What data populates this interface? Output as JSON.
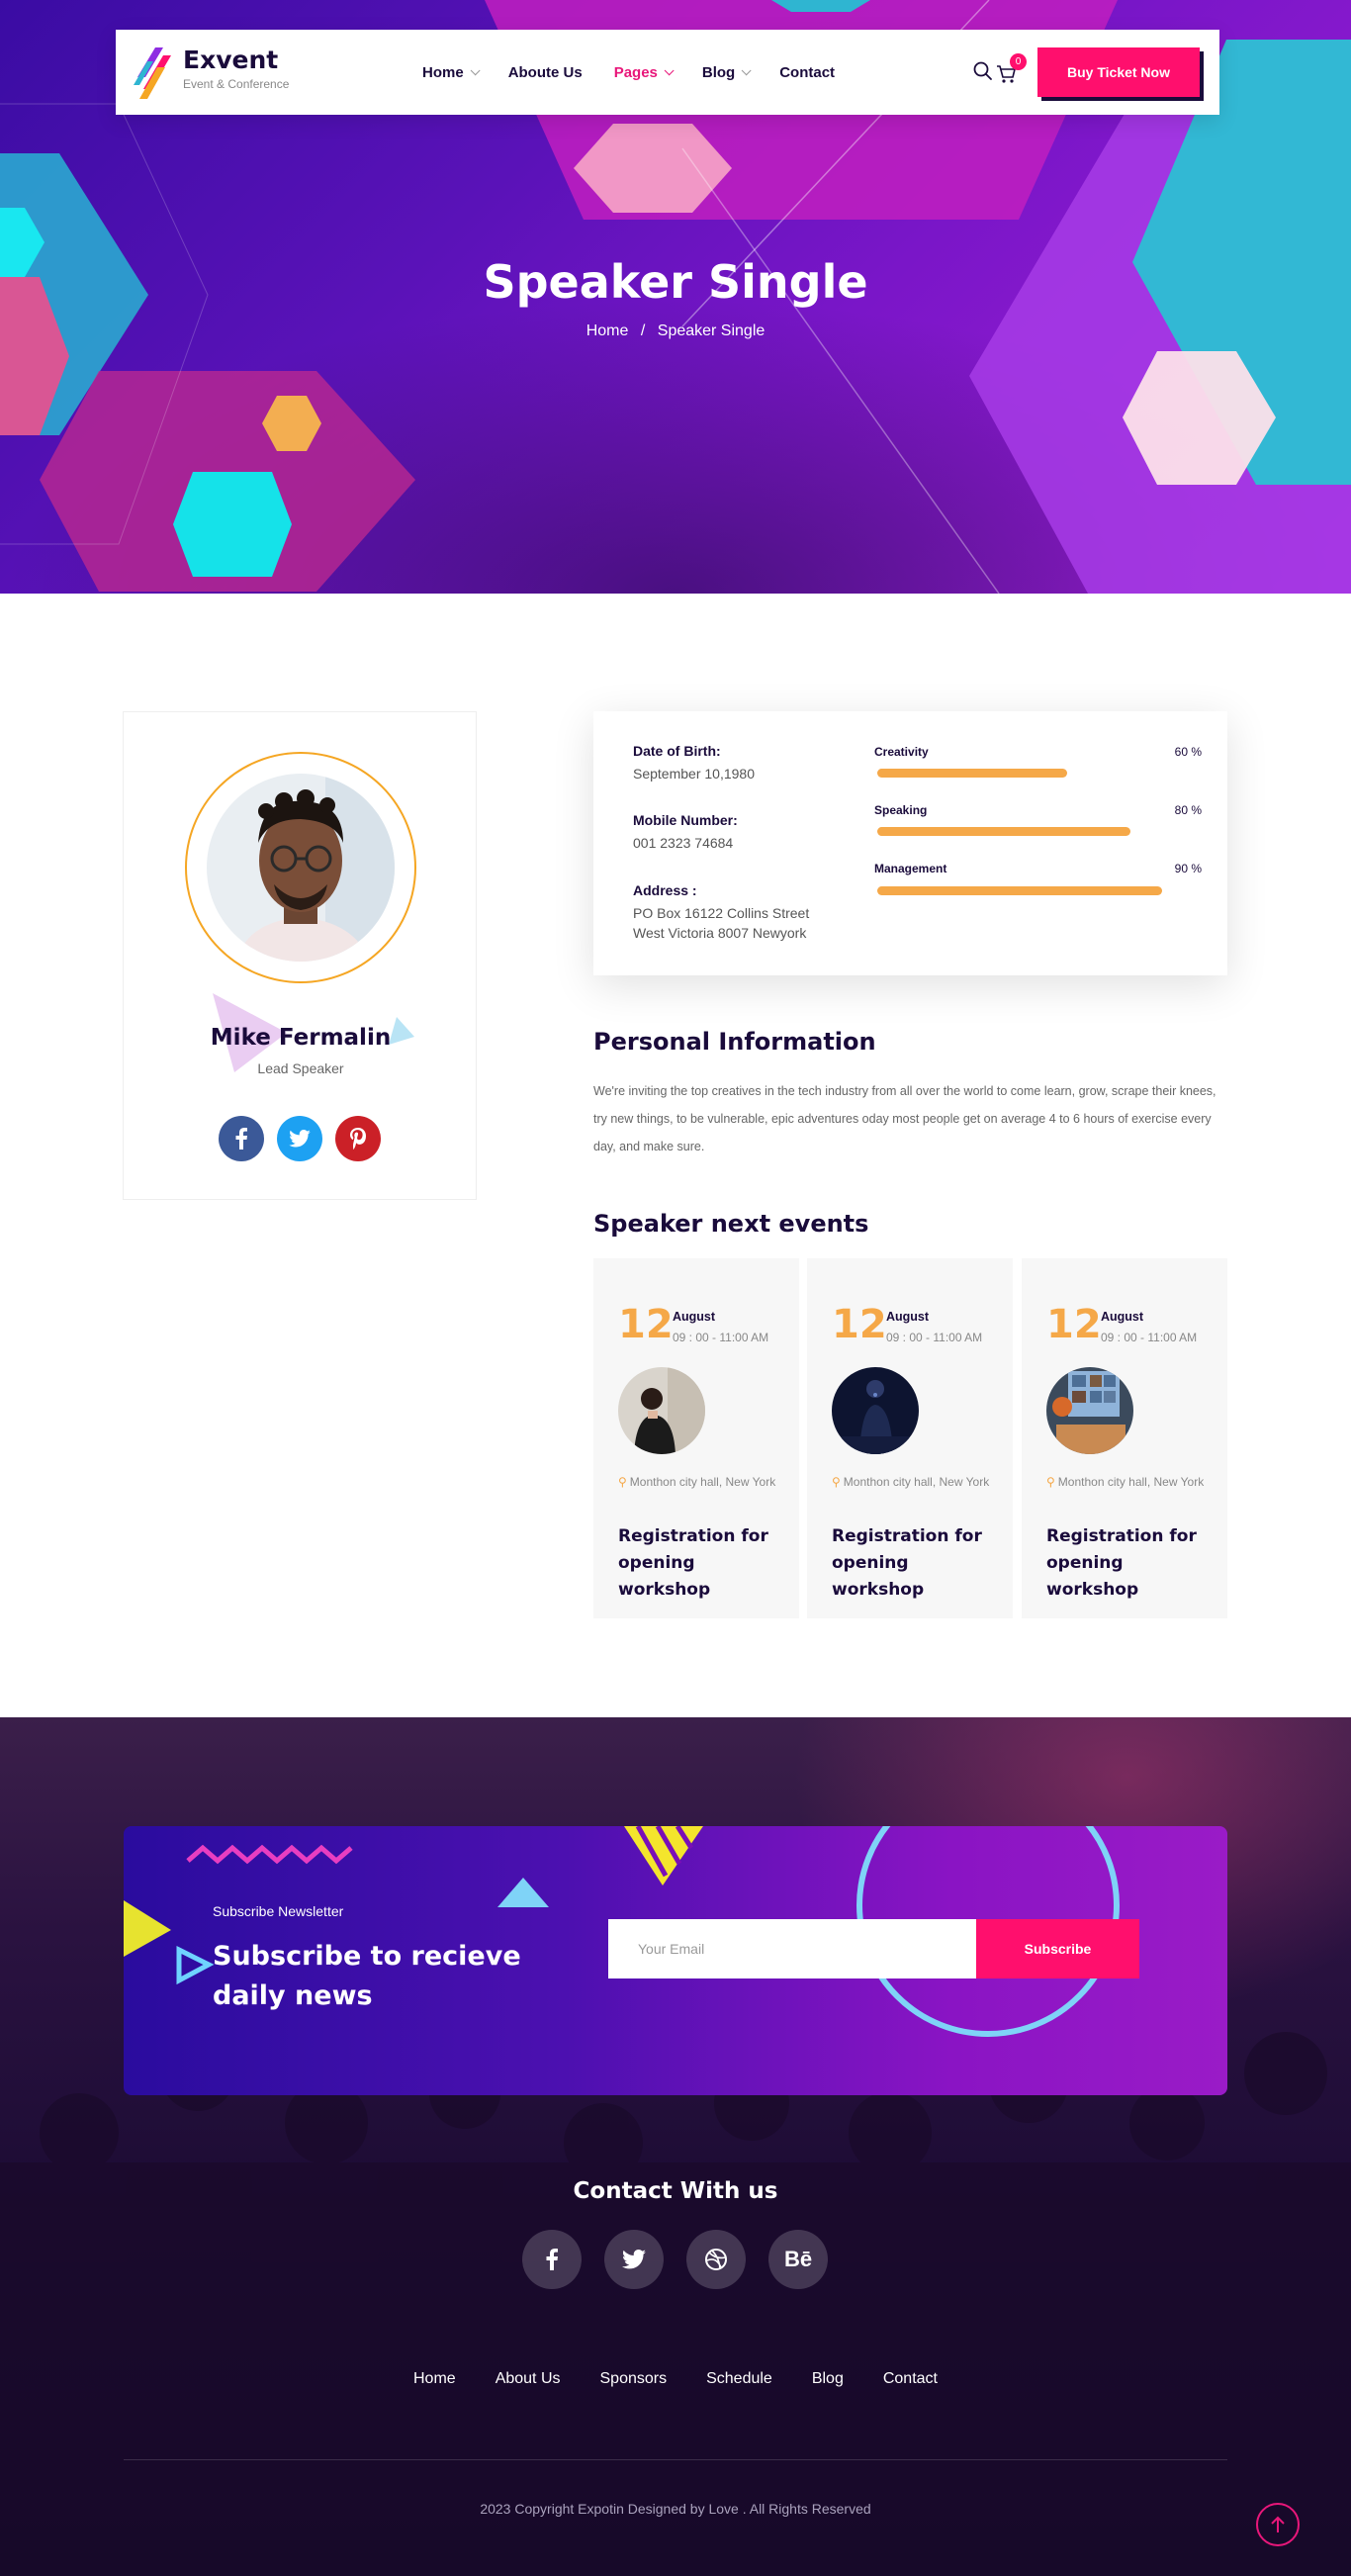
{
  "brand": {
    "name": "Exvent",
    "tagline": "Event & Conference"
  },
  "nav": {
    "items": [
      {
        "label": "Home",
        "has_dropdown": true,
        "active": false
      },
      {
        "label": "Aboute Us",
        "has_dropdown": false,
        "active": false
      },
      {
        "label": "Pages",
        "has_dropdown": true,
        "active": true
      },
      {
        "label": "Blog",
        "has_dropdown": true,
        "active": false
      },
      {
        "label": "Contact",
        "has_dropdown": false,
        "active": false
      }
    ],
    "cart_count": "0",
    "cta_label": "Buy Ticket Now"
  },
  "hero": {
    "title": "Speaker Single",
    "breadcrumb": {
      "home": "Home",
      "separator": "/",
      "current": "Speaker Single"
    }
  },
  "speaker": {
    "name": "Mike Fermalin",
    "role": "Lead Speaker",
    "socials": [
      "facebook-icon",
      "twitter-icon",
      "pinterest-icon"
    ]
  },
  "info": {
    "dob_label": "Date of Birth:",
    "dob_value": "September 10,1980",
    "mobile_label": "Mobile Number:",
    "mobile_value": "001 2323 74684",
    "address_label": "Address :",
    "address_line1": "PO Box 16122 Collins Street",
    "address_line2": "West Victoria 8007 Newyork"
  },
  "skills": [
    {
      "name": "Creativity",
      "percent_label": "60 %",
      "value": 60
    },
    {
      "name": "Speaking",
      "percent_label": "80 %",
      "value": 80
    },
    {
      "name": "Management",
      "percent_label": "90 %",
      "value": 90
    }
  ],
  "personal": {
    "heading": "Personal Information",
    "text": "We're inviting the top creatives in the tech industry from all over the world to come learn, grow, scrape their knees, try new things, to be vulnerable, epic adventures oday most people get on average 4 to 6 hours of exercise every day, and make sure."
  },
  "events": {
    "heading": "Speaker next events",
    "items": [
      {
        "day": "12",
        "month": "August",
        "time": "09 : 00 - 11:00 AM",
        "location": "Monthon city hall, New York",
        "title": "Registration for opening workshop"
      },
      {
        "day": "12",
        "month": "August",
        "time": "09 : 00 - 11:00 AM",
        "location": "Monthon city hall, New York",
        "title": "Registration for opening workshop"
      },
      {
        "day": "12",
        "month": "August",
        "time": "09 : 00 - 11:00 AM",
        "location": "Monthon city hall, New York",
        "title": "Registration for opening workshop"
      }
    ]
  },
  "newsletter": {
    "subtitle": "Subscribe Newsletter",
    "title": "Subscribe to recieve daily news",
    "placeholder": "Your Email",
    "button": "Subscribe"
  },
  "footer": {
    "contact_title": "Contact With us",
    "socials": [
      "facebook-icon",
      "twitter-icon",
      "dribbble-icon",
      "behance-icon"
    ],
    "behance_glyph": "Bē",
    "links": [
      "Home",
      "About Us",
      "Sponsors",
      "Schedule",
      "Blog",
      "Contact"
    ],
    "copyright": "2023 Copyright Expotin Designed by Love . All Rights Reserved"
  },
  "colors": {
    "accent_pink": "#ff0f6d",
    "accent_orange": "#f5a848",
    "navy": "#1a0b3b",
    "facebook": "#3b5998",
    "twitter": "#1da1f2",
    "pinterest": "#cb2027"
  }
}
